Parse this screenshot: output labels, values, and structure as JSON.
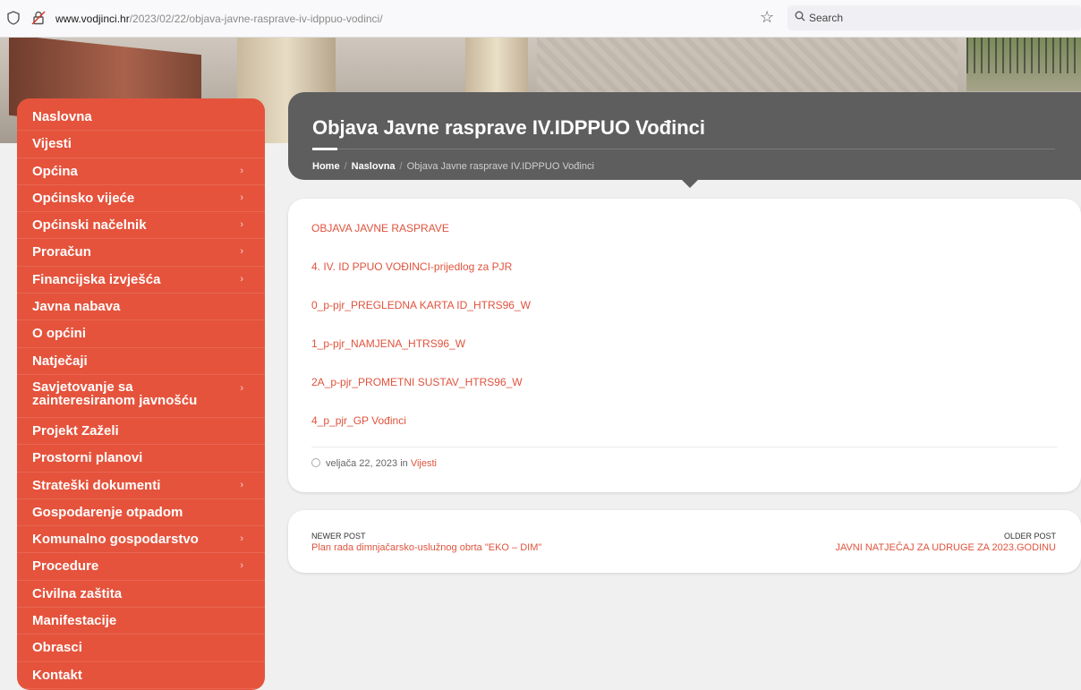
{
  "browser": {
    "url_host": "www.vodjinci.hr",
    "url_path": "/2023/02/22/objava-javne-rasprave-iv-idppuo-vodinci/",
    "search_label": "Search"
  },
  "sidebar": {
    "items": [
      {
        "label": "Naslovna",
        "has_submenu": false
      },
      {
        "label": "Vijesti",
        "has_submenu": false
      },
      {
        "label": "Općina",
        "has_submenu": true
      },
      {
        "label": "Općinsko vijeće",
        "has_submenu": true
      },
      {
        "label": "Općinski načelnik",
        "has_submenu": true
      },
      {
        "label": "Proračun",
        "has_submenu": true
      },
      {
        "label": "Financijska izvješća",
        "has_submenu": true
      },
      {
        "label": "Javna nabava",
        "has_submenu": false
      },
      {
        "label": "O općini",
        "has_submenu": false
      },
      {
        "label": "Natječaji",
        "has_submenu": false
      },
      {
        "label": "Savjetovanje sa zainteresiranom javnošću",
        "has_submenu": true
      },
      {
        "label": "Projekt Zaželi",
        "has_submenu": false
      },
      {
        "label": "Prostorni planovi",
        "has_submenu": false
      },
      {
        "label": "Strateški dokumenti",
        "has_submenu": true
      },
      {
        "label": "Gospodarenje otpadom",
        "has_submenu": false
      },
      {
        "label": "Komunalno gospodarstvo",
        "has_submenu": true
      },
      {
        "label": "Procedure",
        "has_submenu": true
      },
      {
        "label": "Civilna zaštita",
        "has_submenu": false
      },
      {
        "label": "Manifestacije",
        "has_submenu": false
      },
      {
        "label": "Obrasci",
        "has_submenu": false
      },
      {
        "label": "Kontakt",
        "has_submenu": false
      }
    ]
  },
  "header": {
    "title": "Objava Javne rasprave IV.IDPPUO Vođinci",
    "breadcrumb": [
      "Home",
      "Naslovna",
      "Objava Javne rasprave IV.IDPPUO Vođinci"
    ]
  },
  "content": {
    "links": [
      "OBJAVA JAVNE RASPRAVE",
      "4. IV. ID PPUO VOĐINCI-prijedlog za PJR",
      "0_p-pjr_PREGLEDNA KARTA ID_HTRS96_W",
      "1_p-pjr_NAMJENA_HTRS96_W",
      "2A_p-pjr_PROMETNI SUSTAV_HTRS96_W",
      "4_p_pjr_GP Vođinci"
    ],
    "meta": {
      "date": "veljača 22, 2023",
      "in": "in",
      "category": "Vijesti"
    }
  },
  "post_nav": {
    "newer_label": "NEWER POST",
    "newer_title": "Plan rada dimnjačarsko-uslužnog obrta \"EKO – DIM\"",
    "older_label": "OLDER POST",
    "older_title": "JAVNI NATJEČAJ ZA UDRUGE ZA 2023.GODINU"
  },
  "colors": {
    "accent": "#e5533c",
    "header_bg": "#5e5e5e",
    "link": "#e0533d"
  }
}
